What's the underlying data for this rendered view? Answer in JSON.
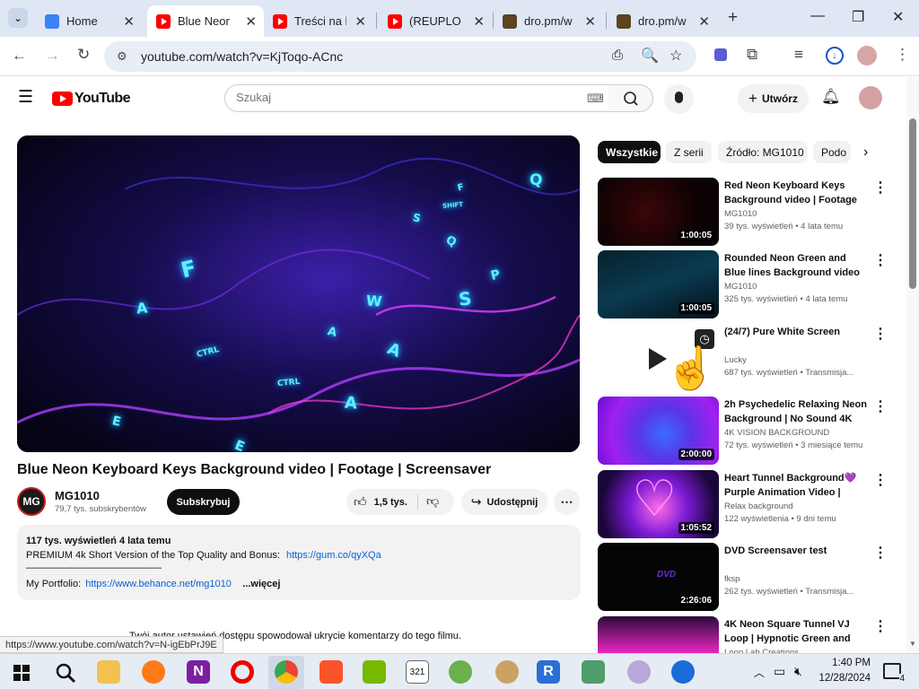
{
  "browser": {
    "tabs": [
      {
        "title": "Home",
        "icon": "generic-page-icon"
      },
      {
        "title": "Blue Neon",
        "icon": "youtube-icon",
        "active": true
      },
      {
        "title": "Treści na k",
        "icon": "youtube-icon"
      },
      {
        "title": "(REUPLOA",
        "icon": "youtube-icon"
      },
      {
        "title": "dro.pm/w",
        "icon": "site-icon"
      },
      {
        "title": "dro.pm/w",
        "icon": "site-icon"
      }
    ],
    "url": "youtube.com/watch?v=KjToqo-ACnc",
    "status_url": "https://www.youtube.com/watch?v=N-igEbPrJ9E"
  },
  "youtube": {
    "logo_text": "YouTube",
    "search_placeholder": "Szukaj",
    "create_label": "Utwórz"
  },
  "video": {
    "title": "Blue Neon Keyboard Keys Background video | Footage | Screensaver",
    "channel": "MG1010",
    "channel_initials": "MG",
    "subscribers": "79,7 tys. subskrybentów",
    "subscribe_label": "Subskrybuj",
    "likes": "1,5 tys.",
    "share_label": "Udostępnij",
    "views_date": "117 tys. wyświetleń  4 lata temu",
    "desc_line1_text": "PREMIUM 4k Short Version of the Top Quality and Bonus:",
    "desc_line1_link": "https://gum.co/qyXQa",
    "desc_separator": "———————————————",
    "desc_line3_text": "My Portfolio:",
    "desc_line3_link": "https://www.behance.net/mg1010",
    "more_label": "...więcej",
    "comments_notice": "Twój autor ustawień dostępu spowodował ukrycie komentarzy do tego filmu.",
    "overlay_keys": [
      "F",
      "A",
      "Q",
      "S",
      "Q",
      "P",
      "S",
      "W",
      "A",
      "A",
      "CTRL",
      "CTRL",
      "A",
      "E",
      "E",
      "F",
      "SHIFT"
    ]
  },
  "chips": [
    "Wszystkie",
    "Z serii",
    "Źródło: MG1010",
    "Podo"
  ],
  "recommendations": [
    {
      "title": "Red Neon Keyboard Keys Background video | Footage |...",
      "channel": "MG1010",
      "meta": "39 tys. wyświetleń  •  4 lata temu",
      "duration": "1:00:05"
    },
    {
      "title": "Rounded Neon Green and Blue lines Background video |...",
      "channel": "MG1010",
      "meta": "325 tys. wyświetleń  •  4 lata temu",
      "duration": "1:00:05"
    },
    {
      "title": "(24/7) Pure White Screen",
      "channel": "Lucky",
      "meta": "687 tys. wyświetleń  •  Transmisja...",
      "duration": ""
    },
    {
      "title": "2h Psychedelic Relaxing Neon Background | No Sound 4K",
      "channel": "4K VISION BACKGROUND",
      "meta": "72 tys. wyświetleń  •  3 miesiące temu",
      "duration": "2:00:00"
    },
    {
      "title": "Heart Tunnel Background💜 Purple Animation Video | Neon...",
      "channel": "Relax background",
      "meta": "122 wyświetlenia  •  9 dni temu",
      "duration": "1:05:52"
    },
    {
      "title": "DVD Screensaver test",
      "channel": "fksp",
      "meta": "262 tys. wyświetleń  •  Transmisja...",
      "duration": "2:26:06"
    },
    {
      "title": "4K Neon Square Tunnel VJ Loop | Hypnotic Green and Blue...",
      "channel": "Loop Lab Creations",
      "meta": "",
      "duration": ""
    }
  ],
  "taskbar": {
    "time": "1:40 PM",
    "date": "12/28/2024",
    "notification_count": "4"
  }
}
